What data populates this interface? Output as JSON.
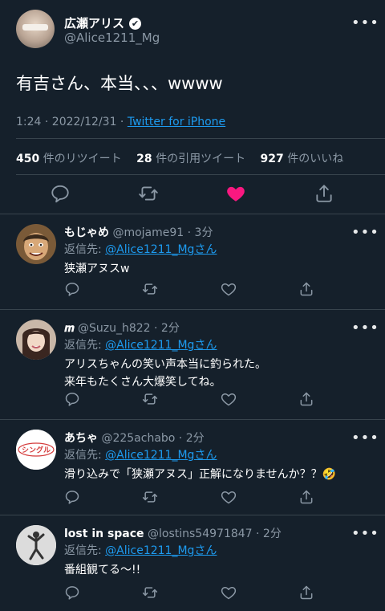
{
  "main": {
    "author_name": "広瀬アリス",
    "verified_mark": "✔",
    "author_handle": "@Alice1211_Mg",
    "text": "有吉さん、本当、、、wwww",
    "time": "1:24 · 2022/12/31 · ",
    "source": "Twitter for iPhone",
    "stats": [
      {
        "count": "450",
        "label": " 件のリツイート"
      },
      {
        "count": "28",
        "label": " 件の引用ツイート"
      },
      {
        "count": "927",
        "label": " 件のいいね"
      }
    ],
    "liked": true,
    "like_color": "#f91880"
  },
  "replies": [
    {
      "name": "もじゃめ",
      "handle": "@mojame91",
      "time": " · 3分",
      "reply_prefix": "返信先: ",
      "reply_to": "@Alice1211_Mgさん",
      "text": "狭瀬アヌスw",
      "avatar_icon": "cartoon-portrait-avatar"
    },
    {
      "name": "𝒎",
      "handle": "@Suzu_h822",
      "time": " · 2分",
      "reply_prefix": "返信先: ",
      "reply_to": "@Alice1211_Mgさん",
      "text": "アリスちゃんの笑い声本当に釣られた。\n来年もたくさん大爆笑してね。",
      "avatar_icon": "smiling-woman-avatar"
    },
    {
      "name": "あちゃ",
      "handle": "@225achabo",
      "time": " · 2分",
      "reply_prefix": "返信先: ",
      "reply_to": "@Alice1211_Mgさん",
      "text": "滑り込みで「狭瀬アヌス」正解になりませんか？？🤣",
      "avatar_icon": "single-label-avatar",
      "avatar_label": "シングル"
    },
    {
      "name": "lost in space",
      "handle": "@lostins54971847",
      "time": " · 2分",
      "reply_prefix": "返信先: ",
      "reply_to": "@Alice1211_Mgさん",
      "text": "番組観てる〜!!",
      "avatar_icon": "dancing-figure-avatar"
    }
  ],
  "icons": {
    "reply": "reply-icon",
    "retweet": "retweet-icon",
    "like": "heart-icon",
    "share": "share-icon",
    "more": "more-icon"
  },
  "colors": {
    "background": "#15202b",
    "link": "#1d9bf0",
    "muted": "#8b98a5",
    "border": "#38444d"
  }
}
